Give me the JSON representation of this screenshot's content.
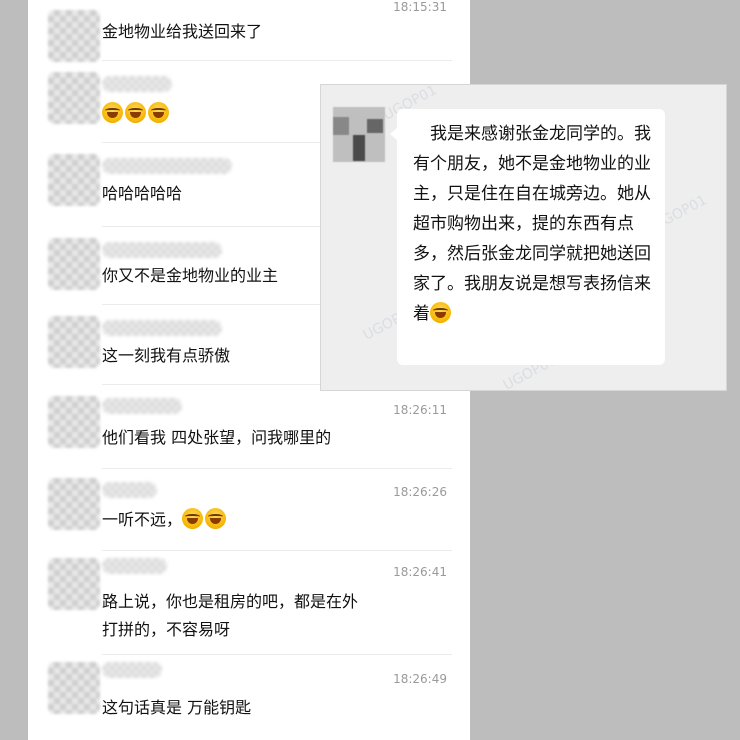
{
  "messages": [
    {
      "time": "18:15:31",
      "text": "金地物业给我送回来了",
      "emojis": 0
    },
    {
      "time": "",
      "text": "",
      "emojis": 3
    },
    {
      "time": "",
      "text": "哈哈哈哈哈",
      "emojis": 0
    },
    {
      "time": "",
      "text": "你又不是金地物业的业主",
      "emojis": 0
    },
    {
      "time": "",
      "text": "这一刻我有点骄傲",
      "emojis": 0
    },
    {
      "time": "18:26:11",
      "text": "他们看我 四处张望，问我哪里的",
      "emojis": 0
    },
    {
      "time": "18:26:26",
      "text": "一听不远，",
      "emojis": 2
    },
    {
      "time": "18:26:41",
      "text": "路上说，你也是租房的吧，都是在外打拼的，不容易呀",
      "emojis": 0
    },
    {
      "time": "18:26:49",
      "text": "这句话真是 万能钥匙",
      "emojis": 0
    }
  ],
  "overlay": {
    "text": "我是来感谢张金龙同学的。我有个朋友，她不是金地物业的业主，只是住在自在城旁边。她从超市购物出来，提的东西有点多，然后张金龙同学就把她送回家了。我朋友说是想写表扬信来着"
  }
}
